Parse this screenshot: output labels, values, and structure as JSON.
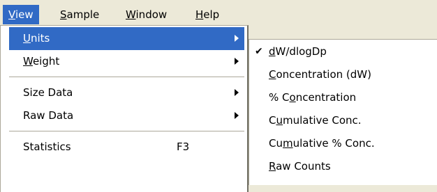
{
  "menubar": {
    "items": [
      {
        "pre": "",
        "key": "V",
        "post": "iew"
      },
      {
        "pre": "",
        "key": "S",
        "post": "ample"
      },
      {
        "pre": "",
        "key": "W",
        "post": "indow"
      },
      {
        "pre": "",
        "key": "H",
        "post": "elp"
      }
    ]
  },
  "view_menu": {
    "items": [
      {
        "pre": "",
        "key": "U",
        "post": "nits"
      },
      {
        "pre": "",
        "key": "W",
        "post": "eight"
      },
      {
        "label": "Size Data"
      },
      {
        "label": "Raw Data"
      },
      {
        "label": "Statistics",
        "shortcut": "F3"
      }
    ]
  },
  "units_submenu": {
    "check_glyph": "✔",
    "items": [
      {
        "pre": "",
        "key": "d",
        "post": "W/dlogDp"
      },
      {
        "pre": "",
        "key": "C",
        "post": "oncentration (dW)"
      },
      {
        "pre": "% C",
        "key": "o",
        "post": "ncentration"
      },
      {
        "pre": "C",
        "key": "u",
        "post": "mulative Conc."
      },
      {
        "pre": "Cu",
        "key": "m",
        "post": "ulative % Conc."
      },
      {
        "pre": "",
        "key": "R",
        "post": "aw Counts"
      }
    ]
  }
}
